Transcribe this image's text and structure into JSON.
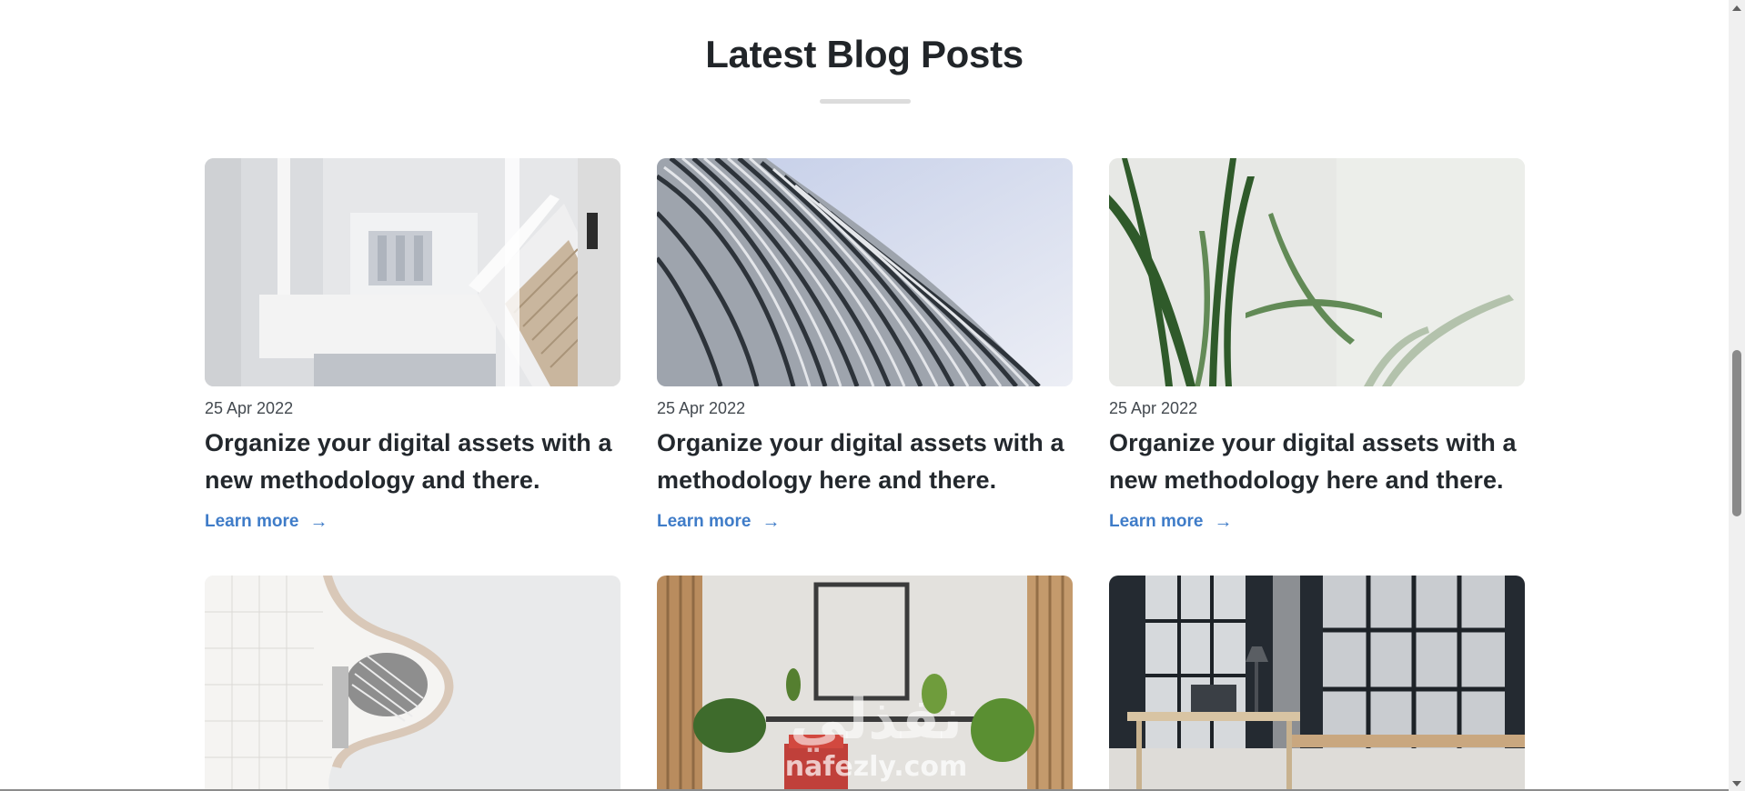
{
  "section": {
    "title": "Latest Blog Posts"
  },
  "posts": [
    {
      "date": "25 Apr 2022",
      "title": "Organize your digital assets with a new methodology and there.",
      "link_label": "Learn more",
      "image": "white-staircase-interior"
    },
    {
      "date": "25 Apr 2022",
      "title": "Organize your digital assets with a methodology here and there.",
      "link_label": "Learn more",
      "image": "ribbed-metal-facade"
    },
    {
      "date": "25 Apr 2022",
      "title": "Organize your digital assets with a new methodology here and there.",
      "link_label": "Learn more",
      "image": "green-plant-leaves"
    },
    {
      "image": "curved-white-building"
    },
    {
      "image": "interior-red-chair-plants"
    },
    {
      "image": "office-desk-window"
    }
  ],
  "watermark": {
    "arabic": "نفذلي",
    "latin": "nafezly.com"
  },
  "colors": {
    "link": "#3f7cc8",
    "heading": "#212529",
    "underline": "#dcdcdc"
  },
  "icons": {
    "link_arrow": "arrow-right-icon",
    "scroll_up": "scroll-up-icon",
    "scroll_down": "scroll-down-icon"
  }
}
